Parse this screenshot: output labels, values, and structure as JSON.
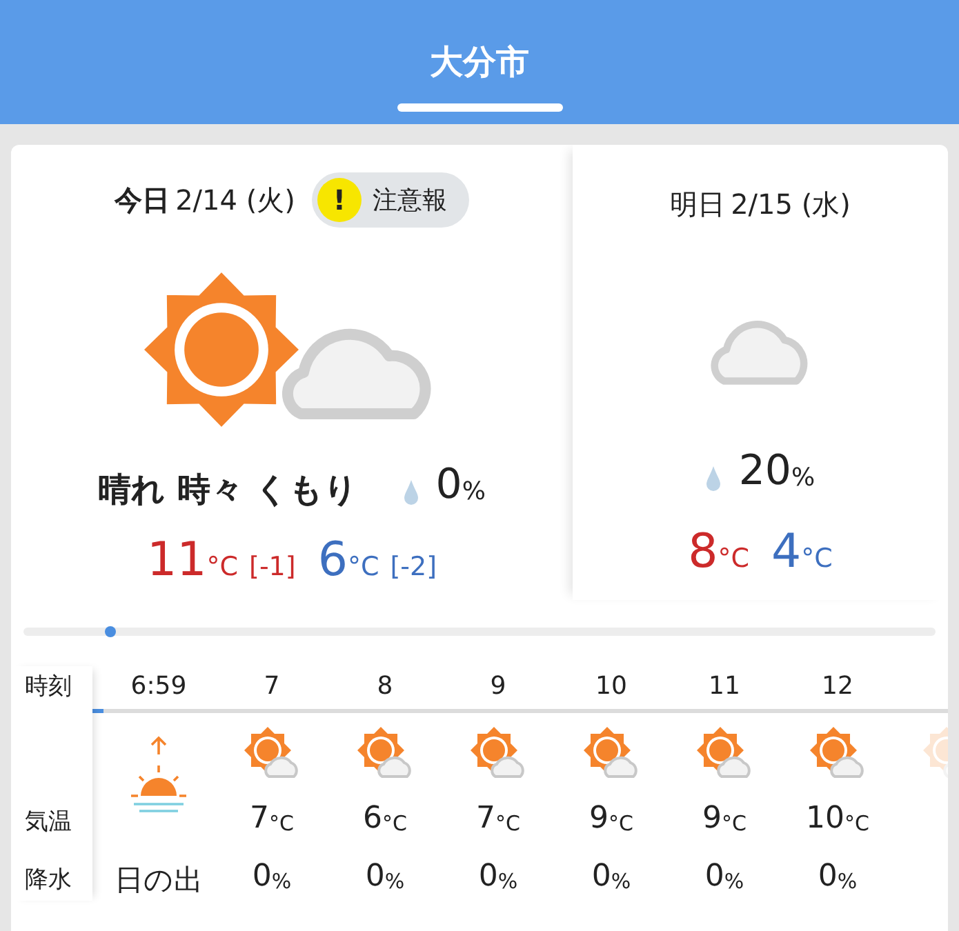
{
  "header": {
    "title": "大分市"
  },
  "today": {
    "day": "今日",
    "date": "2/14 (火)",
    "alert": {
      "mark": "!",
      "text": "注意報"
    },
    "kind": "sun_cloud",
    "weather": "晴れ 時々 くもり",
    "precip": {
      "value": "0",
      "unit": "%"
    },
    "high": {
      "value": "11",
      "unit": "°C",
      "diff": "[-1]"
    },
    "low": {
      "value": "6",
      "unit": "°C",
      "diff": "[-2]"
    }
  },
  "tomorrow": {
    "day": "明日",
    "date": "2/15 (水)",
    "kind": "cloud",
    "precip": {
      "value": "20",
      "unit": "%"
    },
    "high": {
      "value": "8",
      "unit": "°C"
    },
    "low": {
      "value": "4",
      "unit": "°C"
    }
  },
  "timeline": {
    "level": 0.095
  },
  "hourly": {
    "row_labels": [
      "時刻",
      "気温",
      "降水"
    ],
    "columns": [
      {
        "kind": "sunrise",
        "time": "6:59",
        "label": "日の出"
      },
      {
        "kind": "hour",
        "time": "7",
        "temp": "7",
        "temp_unit": "°C",
        "precip": "0",
        "precip_unit": "%"
      },
      {
        "kind": "hour",
        "time": "8",
        "temp": "6",
        "temp_unit": "°C",
        "precip": "0",
        "precip_unit": "%"
      },
      {
        "kind": "hour",
        "time": "9",
        "temp": "7",
        "temp_unit": "°C",
        "precip": "0",
        "precip_unit": "%"
      },
      {
        "kind": "hour",
        "time": "10",
        "temp": "9",
        "temp_unit": "°C",
        "precip": "0",
        "precip_unit": "%"
      },
      {
        "kind": "hour",
        "time": "11",
        "temp": "9",
        "temp_unit": "°C",
        "precip": "0",
        "precip_unit": "%"
      },
      {
        "kind": "hour",
        "time": "12",
        "temp": "10",
        "temp_unit": "°C",
        "precip": "0",
        "precip_unit": "%"
      },
      {
        "kind": "partial"
      }
    ]
  }
}
